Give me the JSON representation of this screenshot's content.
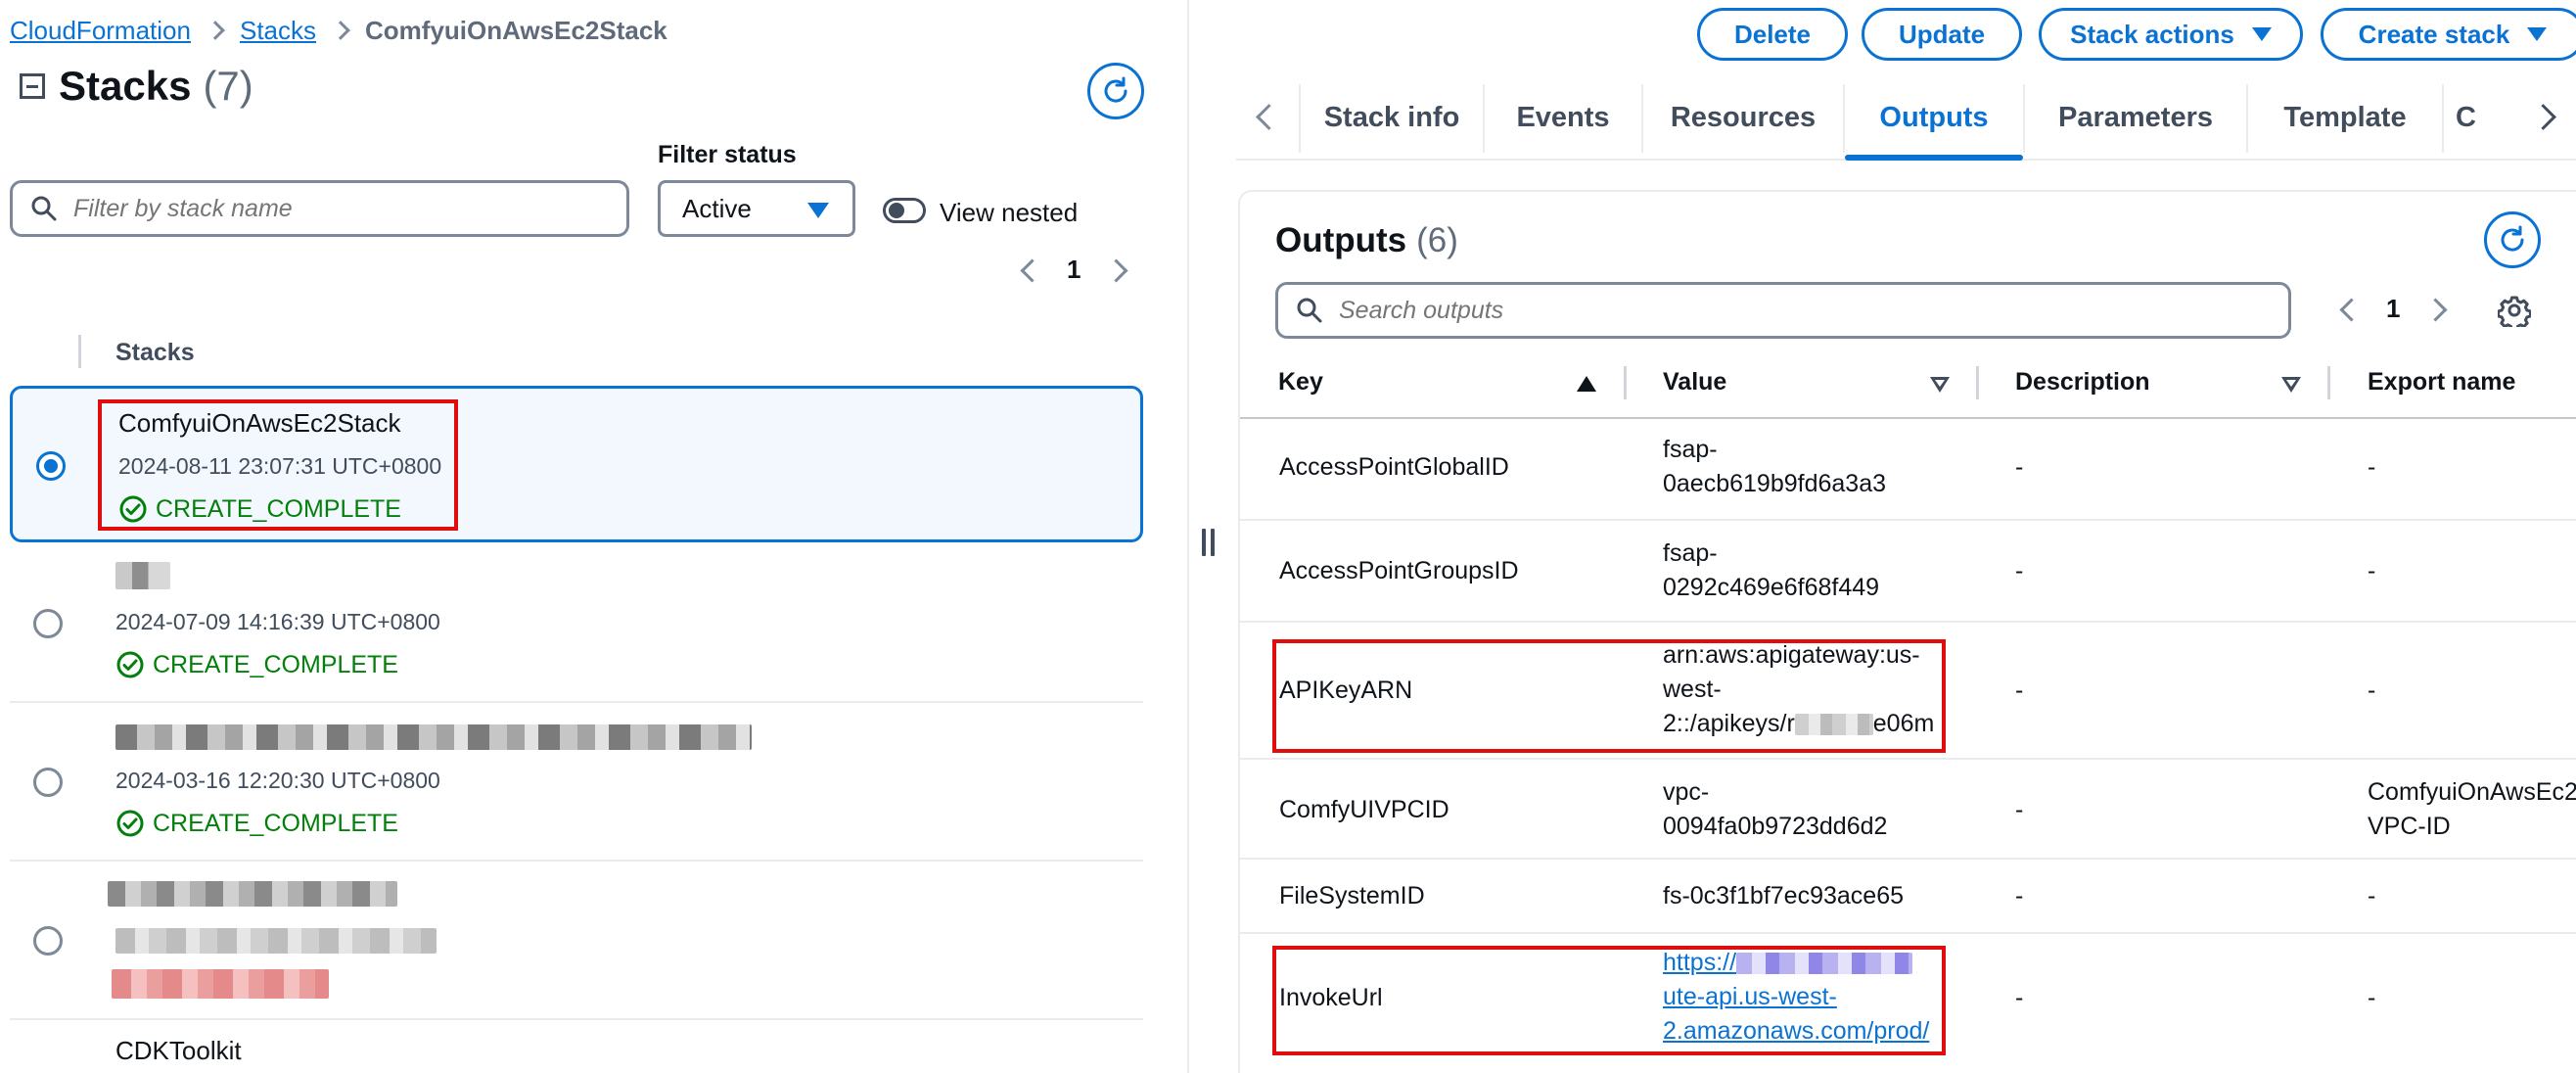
{
  "breadcrumb": {
    "items": [
      "CloudFormation",
      "Stacks"
    ],
    "current": "ComfyuiOnAwsEc2Stack"
  },
  "stacks_panel": {
    "title": "Stacks",
    "count": "(7)",
    "filter_status_label": "Filter status",
    "filter_placeholder": "Filter by stack name",
    "filter_status_value": "Active",
    "view_nested_label": "View nested",
    "page": "1",
    "column_header": "Stacks",
    "items": [
      {
        "name": "ComfyuiOnAwsEc2Stack",
        "date": "2024-08-11 23:07:31 UTC+0800",
        "status": "CREATE_COMPLETE",
        "selected": true
      },
      {
        "name": "",
        "date": "2024-07-09 14:16:39 UTC+0800",
        "status": "CREATE_COMPLETE",
        "selected": false
      },
      {
        "name": "",
        "date": "2024-03-16 12:20:30 UTC+0800",
        "status": "CREATE_COMPLETE",
        "selected": false
      },
      {
        "name": "",
        "date": "",
        "status": "",
        "selected": false
      },
      {
        "name": "CDKToolkit",
        "date": "",
        "status": "",
        "selected": false
      }
    ]
  },
  "actions": {
    "delete": "Delete",
    "update": "Update",
    "stack_actions": "Stack actions",
    "create_stack": "Create stack"
  },
  "tabs": [
    "Stack info",
    "Events",
    "Resources",
    "Outputs",
    "Parameters",
    "Template",
    "C"
  ],
  "active_tab": "Outputs",
  "outputs": {
    "title": "Outputs",
    "count": "(6)",
    "search_placeholder": "Search outputs",
    "page": "1",
    "columns": [
      "Key",
      "Value",
      "Description",
      "Export name"
    ],
    "rows": [
      {
        "key": "AccessPointGlobalID",
        "value": [
          "fsap-",
          "0aecb619b9fd6a3a3"
        ],
        "description": "-",
        "export": [
          "-"
        ]
      },
      {
        "key": "AccessPointGroupsID",
        "value": [
          "fsap-",
          "0292c469e6f68f449"
        ],
        "description": "-",
        "export": [
          "-"
        ]
      },
      {
        "key": "APIKeyARN",
        "value": [
          "arn:aws:apigateway:us-",
          "west-",
          "2::/apikeys/r",
          "e06m"
        ],
        "description": "-",
        "export": [
          "-"
        ]
      },
      {
        "key": "ComfyUIVPCID",
        "value": [
          "vpc-",
          "0094fa0b9723dd6d2"
        ],
        "description": "-",
        "export": [
          "ComfyuiOnAwsEc2",
          "VPC-ID"
        ]
      },
      {
        "key": "FileSystemID",
        "value": [
          "fs-0c3f1bf7ec93ace65"
        ],
        "description": "-",
        "export": [
          "-"
        ]
      },
      {
        "key": "InvokeUrl",
        "value": [
          "https://",
          "ute-api.us-west-",
          "2.amazonaws.com/prod/"
        ],
        "description": "-",
        "export": [
          "-"
        ]
      }
    ]
  },
  "colors": {
    "link": "#0972d3",
    "success": "#037f0c",
    "highlight": "#e00d0d"
  },
  "icons": [
    "search-icon",
    "refresh-icon",
    "settings-gear-icon",
    "status-success-icon",
    "caret-down-icon",
    "chevron-left-icon",
    "chevron-right-icon"
  ]
}
